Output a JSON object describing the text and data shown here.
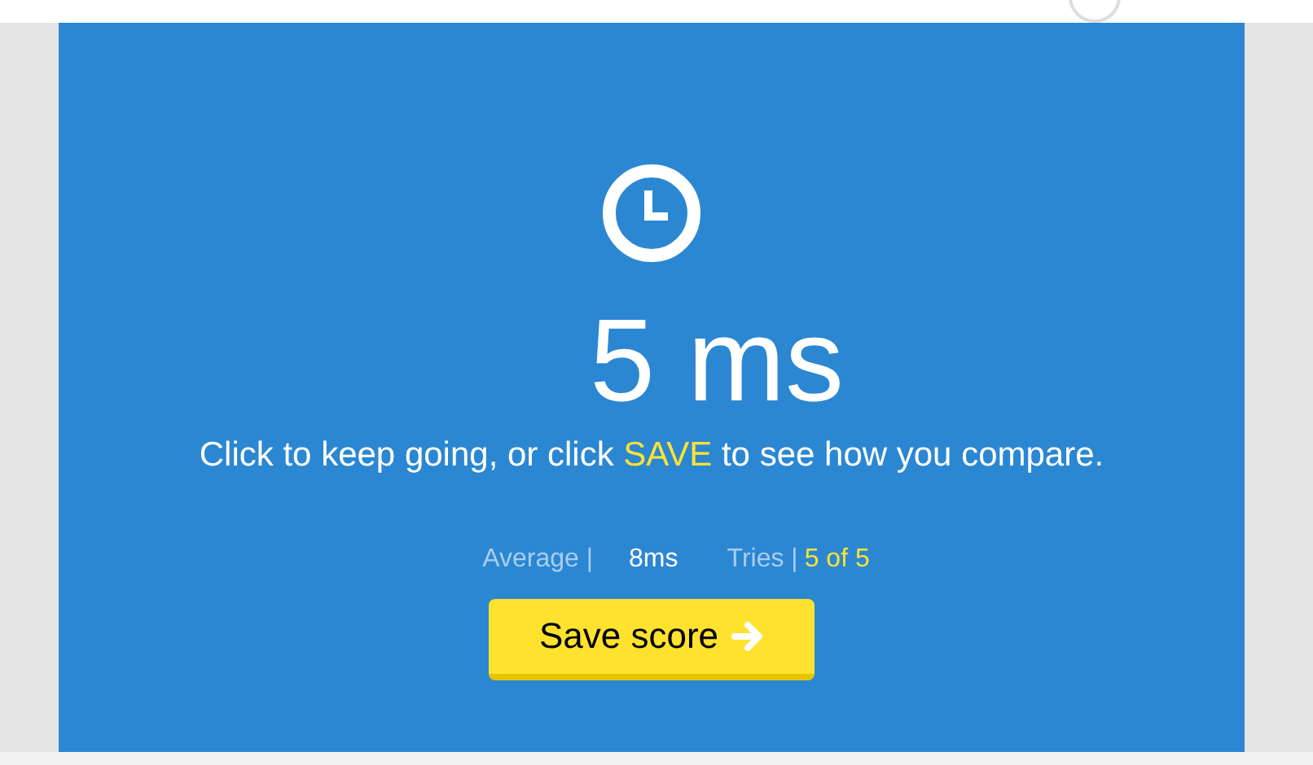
{
  "result": {
    "time": "5 ms",
    "message": [
      {
        "text": "Click to keep going, or click ",
        "highlight": false
      },
      {
        "text": "SAVE",
        "highlight": true
      },
      {
        "text": " to see how you compare.",
        "highlight": false
      }
    ],
    "stats": [
      {
        "label": "Average |",
        "value": "8ms",
        "highlight": false
      },
      {
        "label": "Tries |",
        "value": "5 of 5",
        "highlight": true
      }
    ],
    "button": "Save score"
  }
}
